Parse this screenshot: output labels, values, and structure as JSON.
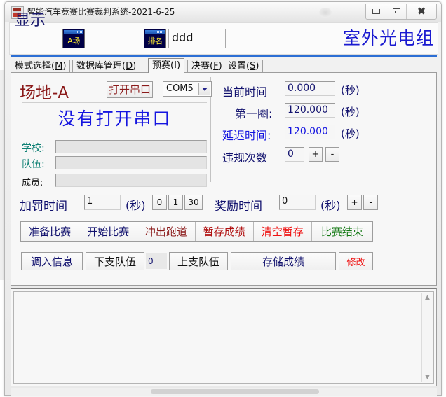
{
  "window": {
    "title": "智能汽车竞赛比赛裁判系统-2021-6-25",
    "app_icon": "app-icon",
    "minimize": "—",
    "maximize": "□",
    "close": "✕"
  },
  "header": {
    "display_label": "显示",
    "field_icon_text": "A场",
    "rank_icon_text": "排名",
    "rank_input_value": "ddd",
    "group_title": "室外光电组"
  },
  "tabs": [
    {
      "label": "模式选择",
      "acc": "M",
      "active": false
    },
    {
      "label": "数据库管理",
      "acc": "D",
      "active": false
    },
    {
      "label": "预赛",
      "acc": "I",
      "active": true
    },
    {
      "label": "决赛",
      "acc": "F",
      "active": false
    },
    {
      "label": "设置",
      "acc": "S",
      "active": false
    }
  ],
  "left": {
    "field_title": "场地-A",
    "open_serial_button": "打开串口",
    "com_port": "COM5",
    "status_text": "没有打开串口",
    "school_label": "学校:",
    "school_value": "",
    "team_label": "队伍:",
    "team_value": "",
    "member_label": "成员:",
    "member_value": ""
  },
  "right": {
    "current_time_label": "当前时间",
    "current_time_value": "0.000",
    "current_time_unit": "(秒)",
    "first_lap_label": "第一圈:",
    "first_lap_value": "120.000",
    "first_lap_unit": "(秒)",
    "delay_time_label": "延迟时间:",
    "delay_time_value": "120.000",
    "delay_time_unit": "(秒)",
    "violation_label": "违规次数",
    "violation_value": "0",
    "violation_plus": "+",
    "violation_minus": "-"
  },
  "penalty": {
    "penalty_label": "加罚时间",
    "penalty_value": "1",
    "penalty_unit": "(秒)",
    "preset_0": "0",
    "preset_1": "1",
    "preset_30": "30",
    "reward_label": "奖励时间",
    "reward_value": "0",
    "reward_unit": "(秒)",
    "reward_plus": "+",
    "reward_minus": "-"
  },
  "actions": [
    {
      "label": "准备比赛",
      "color": "#12126e"
    },
    {
      "label": "开始比赛",
      "color": "#12126e"
    },
    {
      "label": "冲出跑道",
      "color": "#8b1a1a"
    },
    {
      "label": "暂存成绩",
      "color": "#b01010"
    },
    {
      "label": "清空暂存",
      "color": "#ee1111"
    },
    {
      "label": "比赛结束",
      "color": "#117711"
    }
  ],
  "bottom_actions": {
    "load_info": "调入信息",
    "next_team": "下支队伍",
    "team_number": "0",
    "prev_team": "上支队伍",
    "save_score": "存储成绩",
    "modify": "修改",
    "modify_color": "#ee1111"
  },
  "list_area": {
    "content": "",
    "scroll_up_icon": "▲",
    "scroll_down_icon": "▼"
  }
}
